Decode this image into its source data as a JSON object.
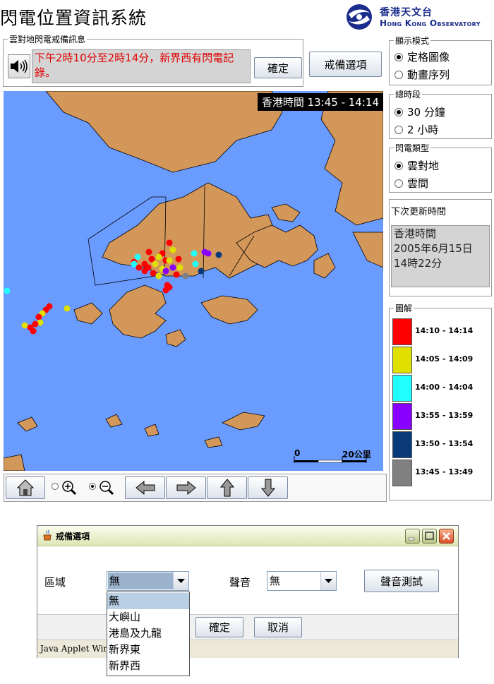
{
  "header": {
    "title": "閃電位置資訊系統",
    "logo_zh": "香港天文台",
    "logo_en": "Hong Kong Observatory"
  },
  "alert": {
    "group_label": "雲對地閃電戒備訊息",
    "message": "下午2時10分至2時14分，新界西有閃電記錄。",
    "confirm_label": "確定",
    "options_button": "戒備選項"
  },
  "display_mode": {
    "label": "顯示模式",
    "options": [
      "定格圖像",
      "動畫序列"
    ],
    "selected": "定格圖像"
  },
  "period": {
    "label": "總時段",
    "options": [
      "30 分鐘",
      "2 小時"
    ],
    "selected": "30 分鐘"
  },
  "lightning_type": {
    "label": "閃電類型",
    "options": [
      "雲對地",
      "雲間"
    ],
    "selected": "雲對地"
  },
  "next_update": {
    "label": "下次更新時間",
    "line1": "香港時間",
    "line2": "2005年6月15日",
    "line3": "14時22分"
  },
  "legend": {
    "label": "圖解",
    "items": [
      {
        "range": "14:10 - 14:14",
        "color": "#ff0000"
      },
      {
        "range": "14:05 - 14:09",
        "color": "#e0e000"
      },
      {
        "range": "14:00 - 14:04",
        "color": "#22ffff"
      },
      {
        "range": "13:55 - 13:59",
        "color": "#8800ff"
      },
      {
        "range": "13:50 - 13:54",
        "color": "#0a3a7a"
      },
      {
        "range": "13:45 - 13:49",
        "color": "#808080"
      }
    ]
  },
  "map": {
    "time_label": "香港時間 13:45 - 14:14",
    "scale_start": "0",
    "scale_end": "20公里",
    "sea_color": "#6a9bff",
    "land_color": "#d4975a"
  },
  "toolbar": {
    "zoom_mode": "zoom-out",
    "buttons": [
      "home-icon",
      "zoom-in-icon",
      "zoom-out-icon",
      "arrow-left-icon",
      "arrow-right-icon",
      "arrow-up-icon",
      "arrow-down-icon"
    ]
  },
  "dialog": {
    "title": "戒備選項",
    "region_label": "區域",
    "region_value": "無",
    "sound_label": "聲音",
    "sound_value": "無",
    "sound_test_button": "聲音測試",
    "confirm_button": "確定",
    "cancel_button": "取消",
    "status_text": "Java Applet Window",
    "region_options": [
      "無",
      "大嶼山",
      "港島及九龍",
      "新界東",
      "新界西"
    ],
    "region_selected": "無"
  }
}
